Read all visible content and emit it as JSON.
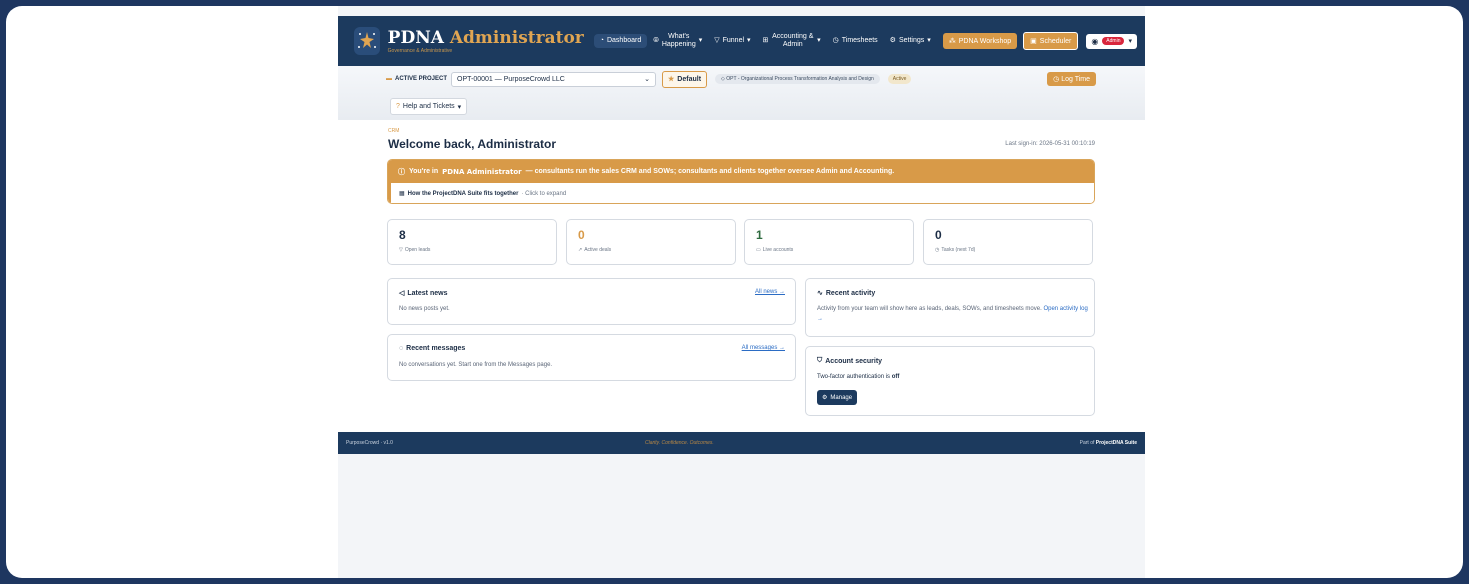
{
  "brand": {
    "title_main": "PDNA",
    "title_accent": "Administrator",
    "subtitle": "Governance & Administrative"
  },
  "nav": {
    "dashboard": "Dashboard",
    "whats_happening": "What's Happening",
    "funnel": "Funnel",
    "accounting_admin": "Accounting & Admin",
    "timesheets": "Timesheets",
    "settings": "Settings",
    "workshop": "PDNA Workshop",
    "scheduler": "Scheduler",
    "user_badge": "Admin"
  },
  "project_bar": {
    "label": "ACTIVE PROJECT",
    "selected": "OPT-00001 — PurposeCrowd LLC",
    "default_label": "Default",
    "opt_chip": "OPT - Organizational Process Transformation Analysis and Design",
    "status": "Active",
    "log_time": "Log Time",
    "help": "Help and Tickets"
  },
  "main": {
    "section": "CRM",
    "welcome": "Welcome back, Administrator",
    "last_signin": "Last sign-in: 2026-05-31 00:10:19",
    "banner_prefix": "You're in",
    "banner_bold": "PDNA Administrator",
    "banner_rest": "— consultants run the sales CRM and SOWs; consultants and clients together oversee Admin and Accounting.",
    "suite_link": "How the ProjectDNA Suite fits together",
    "suite_hint": "· Click to expand"
  },
  "stats": [
    {
      "value": "8",
      "label": "Open leads",
      "color": "#1c2d45"
    },
    {
      "value": "0",
      "label": "Active deals",
      "color": "#d89a48"
    },
    {
      "value": "1",
      "label": "Live accounts",
      "color": "#2e6b3f"
    },
    {
      "value": "0",
      "label": "Tasks (next 7d)",
      "color": "#1c2d45"
    }
  ],
  "news": {
    "title": "Latest news",
    "link": "All news →",
    "body": "No news posts yet."
  },
  "messages": {
    "title": "Recent messages",
    "link": "All messages →",
    "body": "No conversations yet. Start one from the Messages page."
  },
  "activity": {
    "title": "Recent activity",
    "body": "Activity from your team will show here as leads, deals, SOWs, and timesheets move.",
    "link": "Open activity log →"
  },
  "security": {
    "title": "Account security",
    "text": "Two-factor authentication is",
    "state": "off",
    "button": "Manage"
  },
  "footer": {
    "left": "PurposeCrowd · v1.0",
    "middle": "Clarity. Confidence. Outcomes.",
    "right_prefix": "Part of",
    "right_bold": "ProjectDNA Suite"
  }
}
